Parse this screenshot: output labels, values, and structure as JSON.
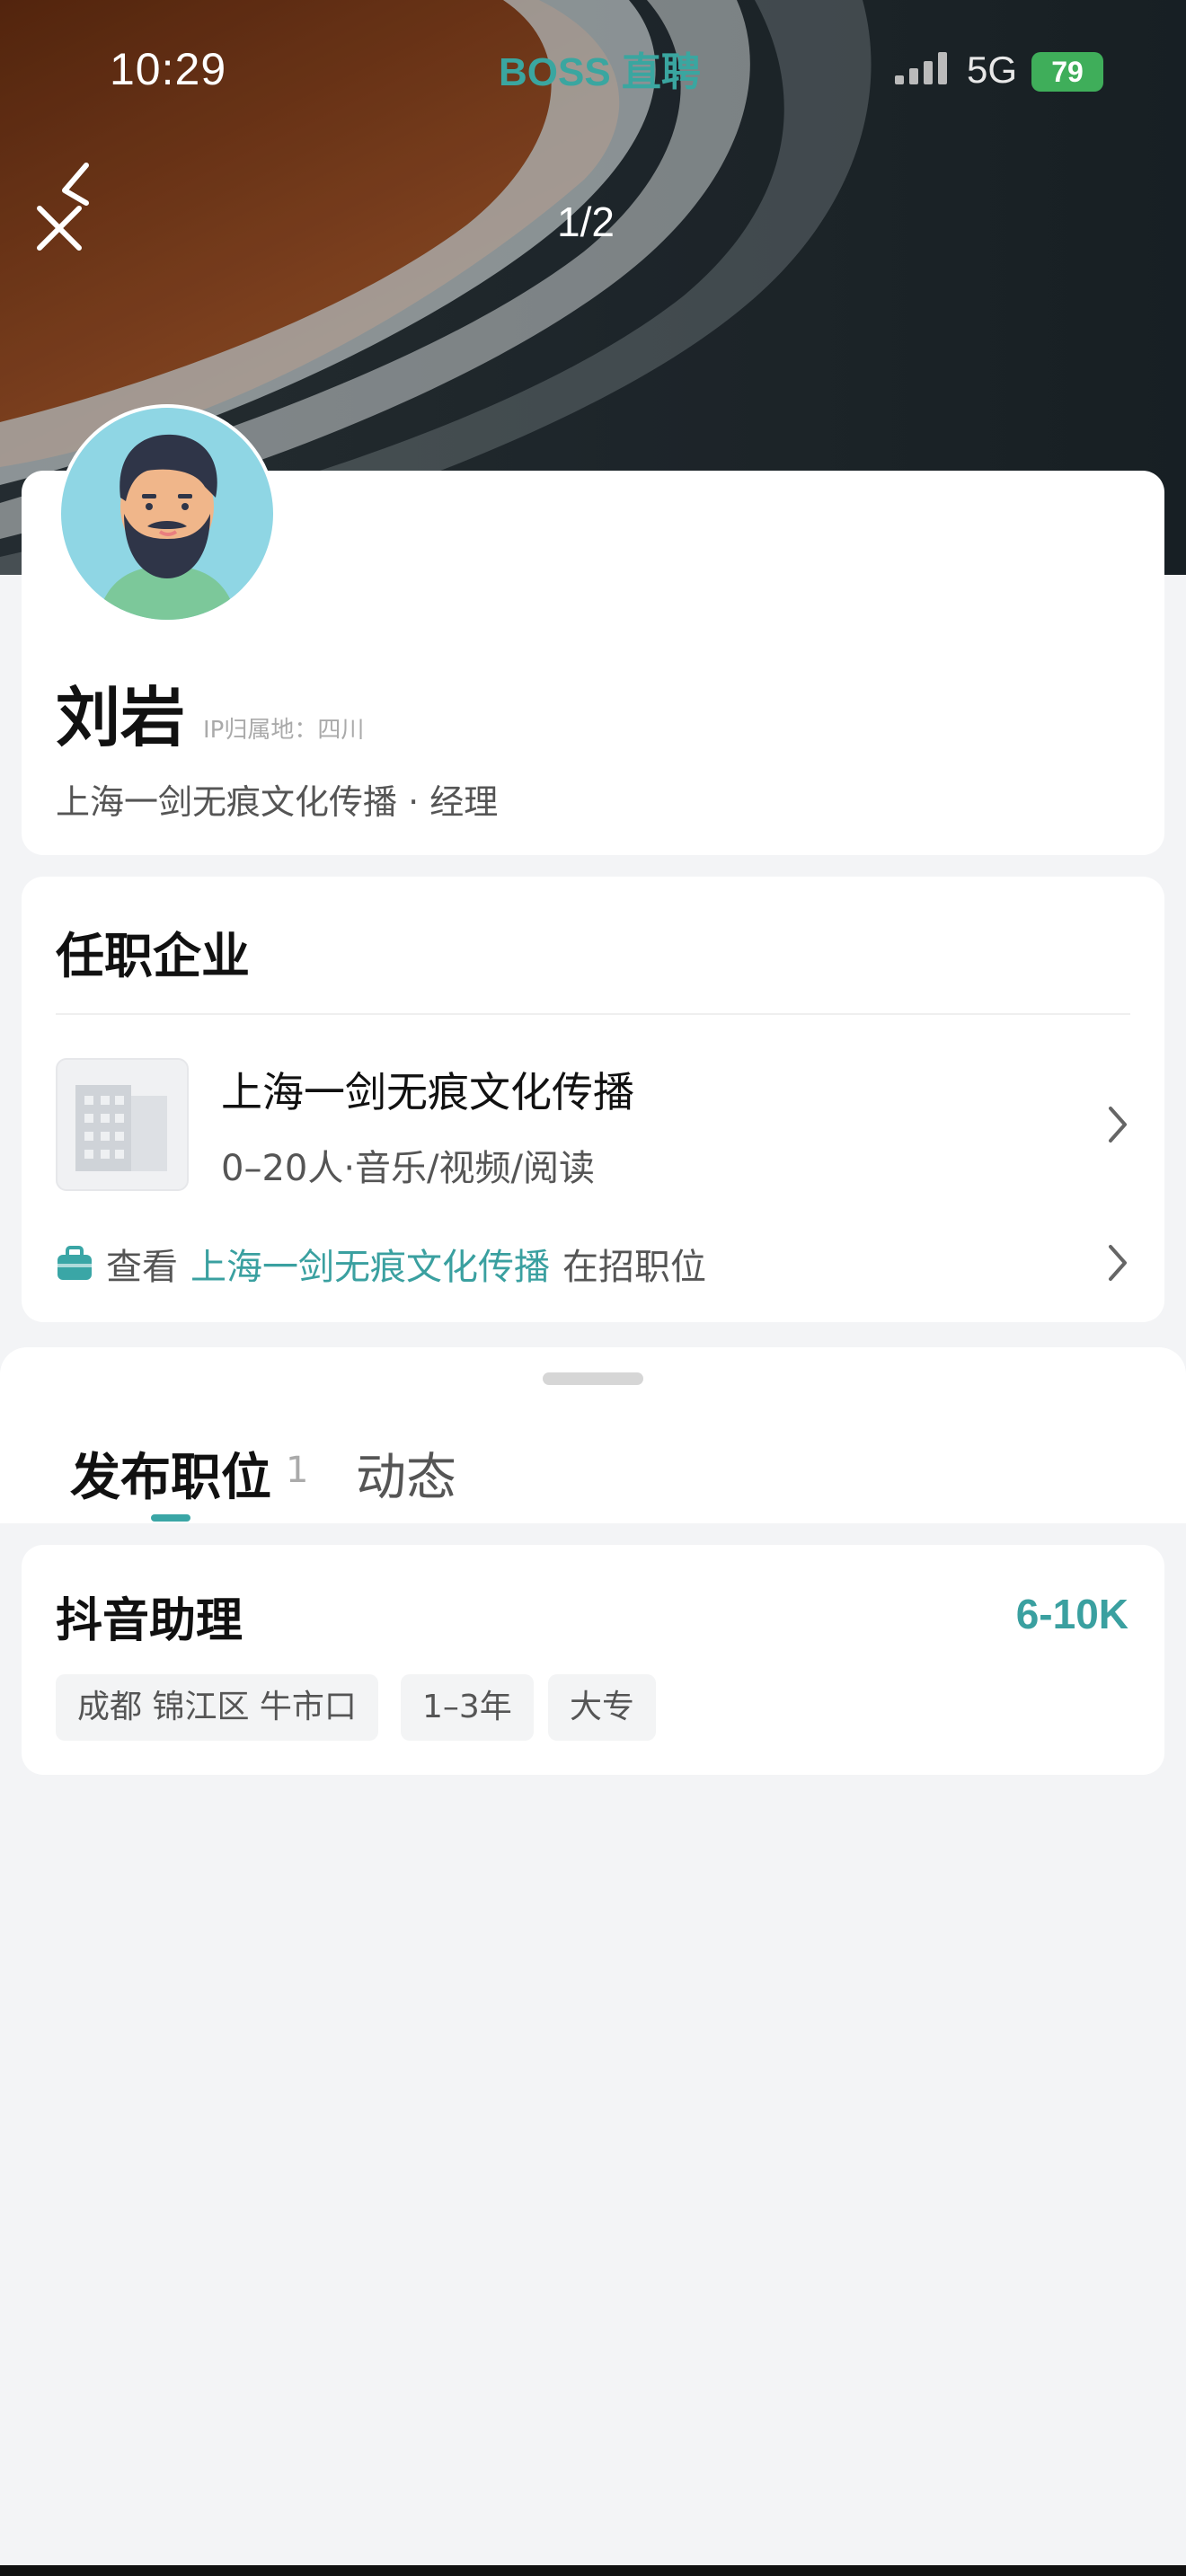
{
  "status_bar": {
    "time": "10:29",
    "brand": "BOSS 直聘",
    "network": "5G",
    "battery": "79"
  },
  "header": {
    "pager": "1/2"
  },
  "profile": {
    "name": "刘岩",
    "ip_location": "IP归属地：四川",
    "title_line": "上海一剑无痕文化传播 · 经理"
  },
  "company_section": {
    "title": "任职企业",
    "company_name": "上海一剑无痕文化传播",
    "company_meta": "0–20人·音乐/视频/阅读",
    "jobs_link_prefix": "查看",
    "jobs_link_company": "上海一剑无痕文化传播",
    "jobs_link_suffix": "在招职位"
  },
  "tabs": {
    "active_label": "发布职位",
    "active_count": "1",
    "inactive_label": "动态"
  },
  "job": {
    "title": "抖音助理",
    "salary": "6-10K",
    "tags": [
      "成都 锦江区 牛市口",
      "1–3年",
      "大专"
    ]
  },
  "colors": {
    "accent": "#3aa0a0",
    "battery": "#3fae5a"
  }
}
